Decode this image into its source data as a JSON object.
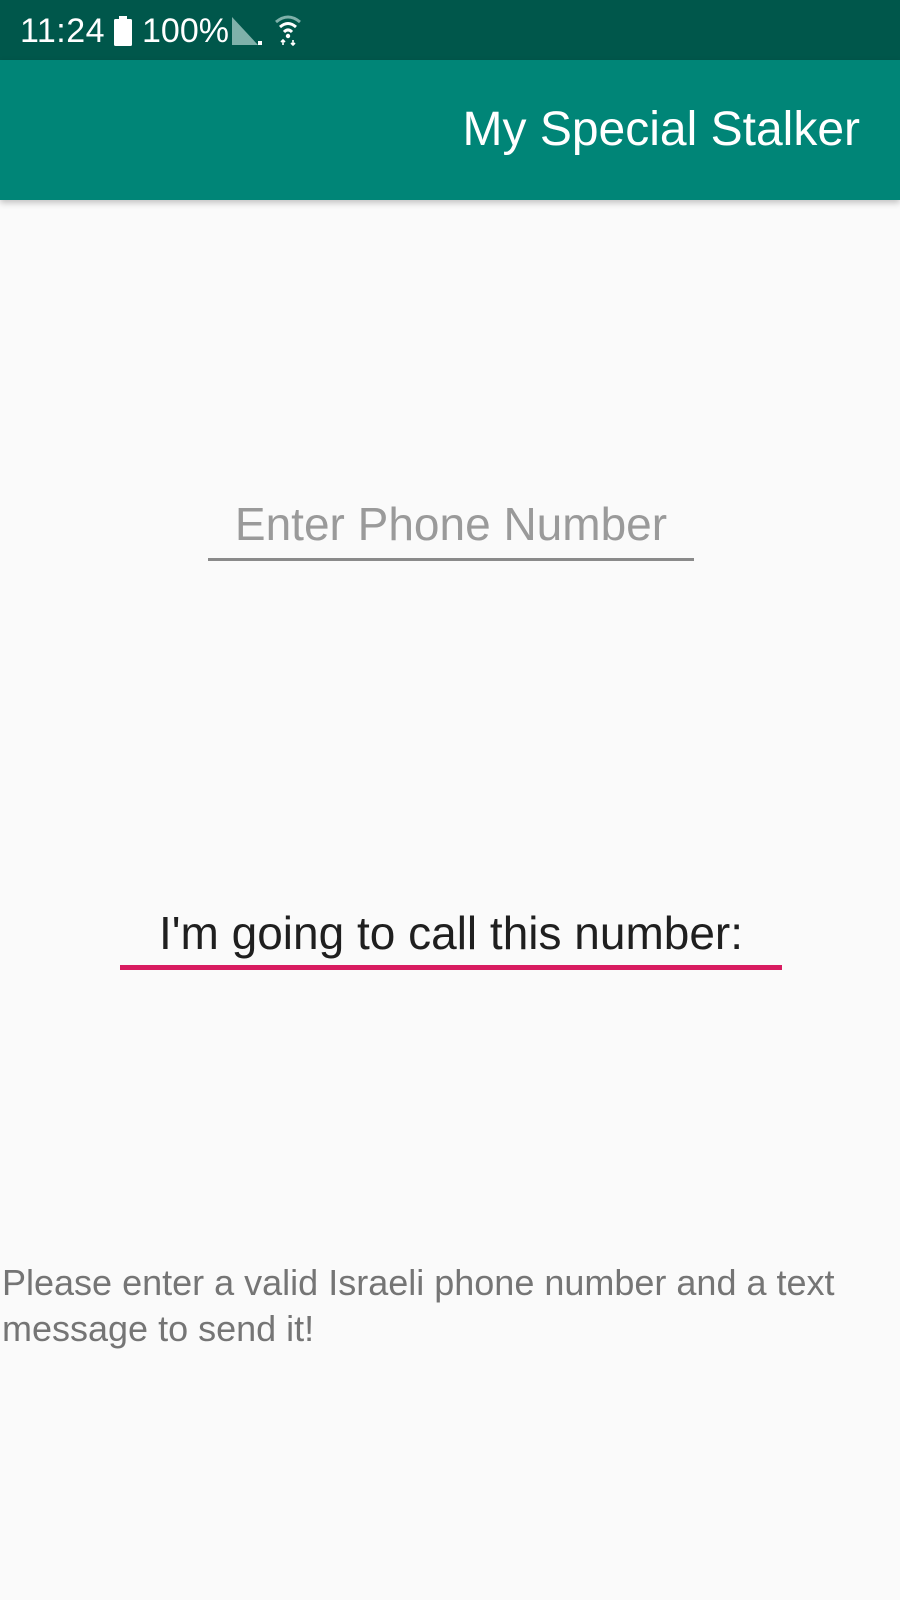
{
  "status_bar": {
    "time": "11:24",
    "battery": "100%",
    "background_color": "#00574b",
    "icons": [
      "battery-icon",
      "signal-icon",
      "wifi-icon"
    ]
  },
  "app_bar": {
    "title": "My Special Stalker",
    "background_color": "#008577"
  },
  "phone_input": {
    "value": "",
    "placeholder": "Enter Phone Number"
  },
  "call_label": {
    "text": "I'm going to call this number:",
    "underline_color": "#d81b60"
  },
  "instruction": {
    "text": "Please enter a valid Israeli phone number and a text message to send it!"
  }
}
